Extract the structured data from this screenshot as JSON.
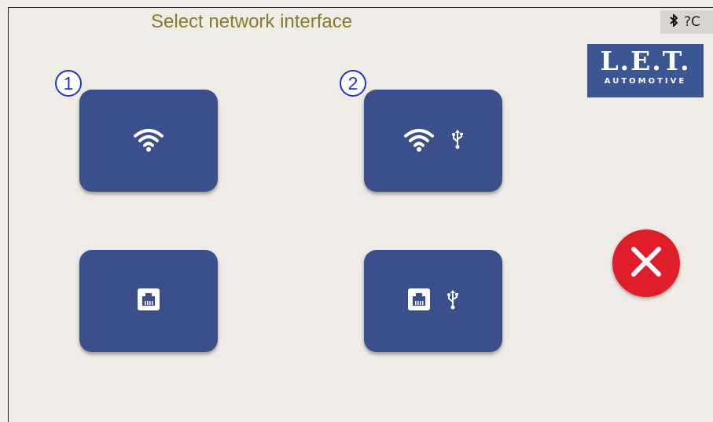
{
  "header": {
    "title": "Select network interface"
  },
  "status_bar": {
    "bluetooth_icon": "bluetooth-icon",
    "text": "?C"
  },
  "logo": {
    "main": "L.E.T.",
    "sub": "AUTOMOTIVE"
  },
  "buttons": [
    {
      "badge": "1",
      "icons": [
        "wifi-icon"
      ]
    },
    {
      "badge": "2",
      "icons": [
        "wifi-icon",
        "usb-icon"
      ]
    },
    {
      "badge": "",
      "icons": [
        "ethernet-icon"
      ]
    },
    {
      "badge": "",
      "icons": [
        "ethernet-icon",
        "usb-icon"
      ]
    }
  ],
  "close_button": {
    "icon": "close-icon",
    "color": "#e01e29"
  },
  "colors": {
    "button": "#3b4f8c",
    "title": "#8a7a2c",
    "logo": "#3a5693"
  }
}
